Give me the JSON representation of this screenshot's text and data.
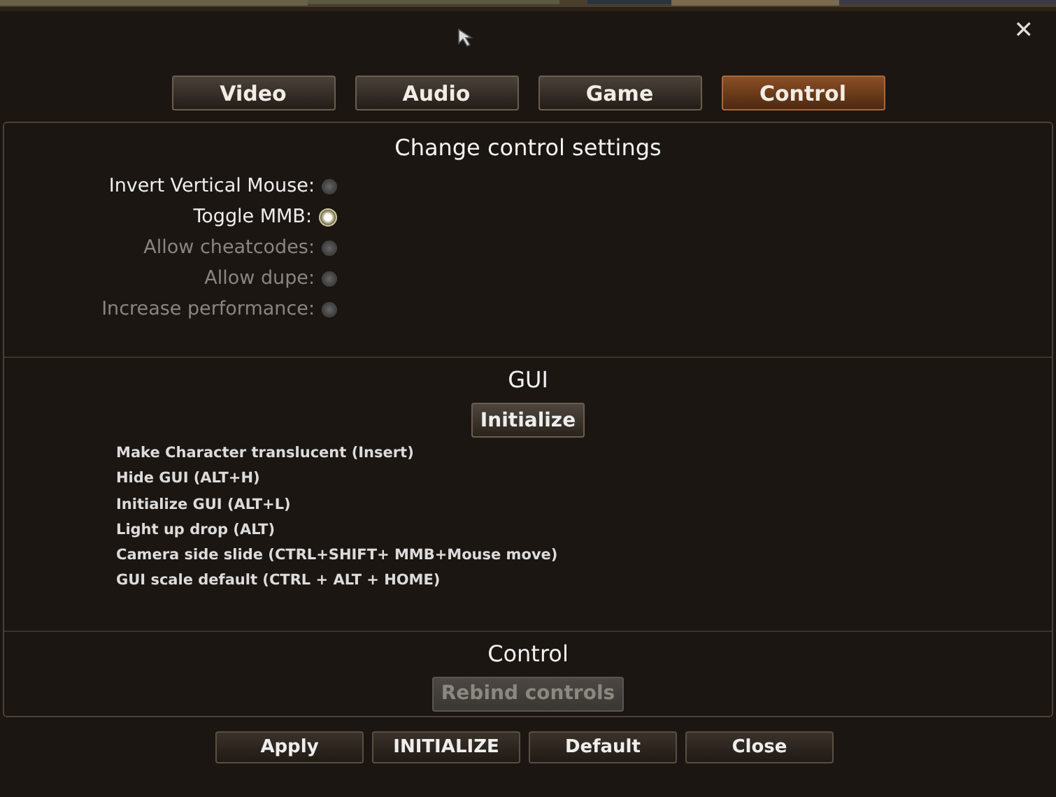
{
  "window": {
    "close": "✕"
  },
  "tabs": [
    {
      "label": "Video",
      "selected": false
    },
    {
      "label": "Audio",
      "selected": false
    },
    {
      "label": "Game",
      "selected": false
    },
    {
      "label": "Control",
      "selected": true
    }
  ],
  "settings": {
    "title": "Change control settings",
    "options": [
      {
        "label": "Invert Vertical Mouse:",
        "checked": false,
        "disabled": false
      },
      {
        "label": "Toggle MMB:",
        "checked": true,
        "disabled": false
      },
      {
        "label": "Allow cheatcodes:",
        "checked": false,
        "disabled": true
      },
      {
        "label": "Allow dupe:",
        "checked": false,
        "disabled": true
      },
      {
        "label": "Increase performance:",
        "checked": false,
        "disabled": true
      }
    ]
  },
  "gui": {
    "title": "GUI",
    "button": {
      "label": "Initialize",
      "disabled": false
    },
    "hotkeys": [
      "Make Character translucent (Insert)",
      "Hide GUI (ALT+H)",
      "Initialize GUI (ALT+L)",
      "Light up drop (ALT)",
      "Camera side slide (CTRL+SHIFT+ MMB+Mouse move)",
      "GUI scale default (CTRL + ALT + HOME)"
    ]
  },
  "control": {
    "title": "Control",
    "button": {
      "label": "Rebind controls",
      "disabled": true
    }
  },
  "buttons": [
    "Apply",
    "INITIALIZE",
    "Default",
    "Close"
  ]
}
